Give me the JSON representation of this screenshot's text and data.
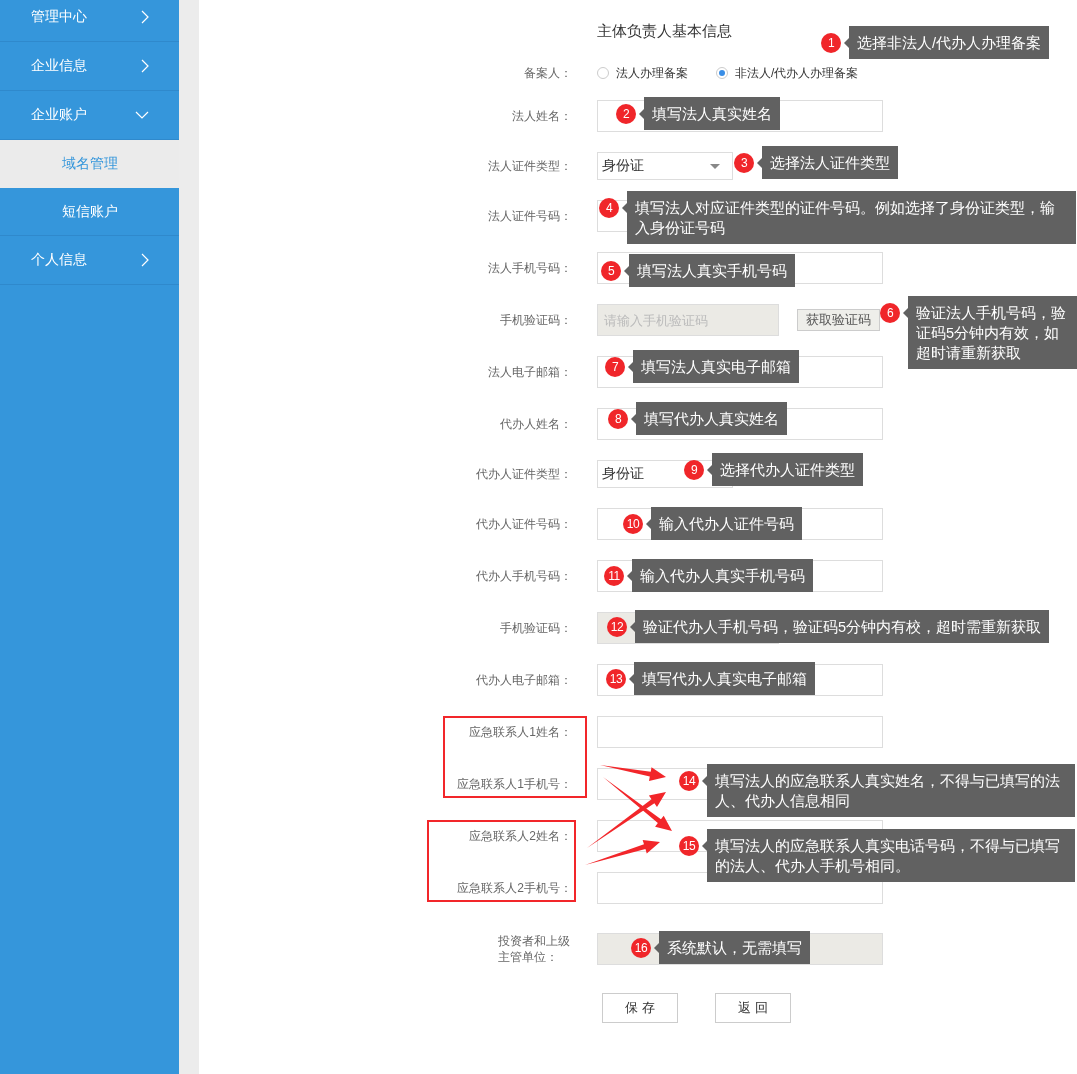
{
  "sidebar": {
    "items": [
      {
        "label": "管理中心",
        "expanded": false
      },
      {
        "label": "企业信息",
        "expanded": false
      },
      {
        "label": "企业账户",
        "expanded": true,
        "children": [
          {
            "label": "域名管理",
            "selected": true
          },
          {
            "label": "短信账户",
            "selected": false
          }
        ]
      },
      {
        "label": "个人信息",
        "expanded": false
      }
    ]
  },
  "form": {
    "title": "主体负责人基本信息",
    "filer": {
      "label": "备案人：",
      "options": [
        {
          "label": "法人办理备案",
          "selected": false
        },
        {
          "label": "非法人/代办人办理备案",
          "selected": true
        }
      ]
    },
    "fields": [
      {
        "label": "法人姓名：",
        "kind": "text"
      },
      {
        "label": "法人证件类型：",
        "kind": "select",
        "value": "身份证"
      },
      {
        "label": "法人证件号码：",
        "kind": "text"
      },
      {
        "label": "法人手机号码：",
        "kind": "text"
      },
      {
        "label": "手机验证码：",
        "kind": "code",
        "placeholder": "请输入手机验证码",
        "button": "获取验证码"
      },
      {
        "label": "法人电子邮箱：",
        "kind": "text"
      },
      {
        "label": "代办人姓名：",
        "kind": "text"
      },
      {
        "label": "代办人证件类型：",
        "kind": "select",
        "value": "身份证"
      },
      {
        "label": "代办人证件号码：",
        "kind": "text"
      },
      {
        "label": "代办人手机号码：",
        "kind": "text"
      },
      {
        "label": "手机验证码：",
        "kind": "code"
      },
      {
        "label": "代办人电子邮箱：",
        "kind": "text"
      },
      {
        "label": "应急联系人1姓名：",
        "kind": "text"
      },
      {
        "label": "应急联系人1手机号：",
        "kind": "text"
      },
      {
        "label": "应急联系人2姓名：",
        "kind": "text"
      },
      {
        "label": "应急联系人2手机号：",
        "kind": "text"
      },
      {
        "label": "投资者和上级主管单位：",
        "kind": "readonly"
      }
    ],
    "buttons": [
      "保 存",
      "返 回"
    ]
  },
  "callouts": [
    {
      "number": "1",
      "text": "选择非法人/代办人办理备案"
    },
    {
      "number": "2",
      "text": "填写法人真实姓名"
    },
    {
      "number": "3",
      "text": "选择法人证件类型"
    },
    {
      "number": "4",
      "text": "填写法人对应证件类型的证件号码。例如选择了身份证类型，输入身份证号码"
    },
    {
      "number": "5",
      "text": "填写法人真实手机号码"
    },
    {
      "number": "6",
      "text": "验证法人手机号码，验证码5分钟内有效，如超时请重新获取"
    },
    {
      "number": "7",
      "text": "填写法人真实电子邮箱"
    },
    {
      "number": "8",
      "text": "填写代办人真实姓名"
    },
    {
      "number": "9",
      "text": "选择代办人证件类型"
    },
    {
      "number": "10",
      "text": "输入代办人证件号码"
    },
    {
      "number": "11",
      "text": "输入代办人真实手机号码"
    },
    {
      "number": "12",
      "text": "验证代办人手机号码，验证码5分钟内有校，超时需重新获取"
    },
    {
      "number": "13",
      "text": "填写代办人真实电子邮箱"
    },
    {
      "number": "14",
      "text": "填写法人的应急联系人真实姓名，不得与已填写的法人、代办人信息相同"
    },
    {
      "number": "15",
      "text": "填写法人的应急联系人真实电话号码，不得与已填写的法人、代办人手机号相同。"
    },
    {
      "number": "16",
      "text": "系统默认，无需填写"
    }
  ]
}
